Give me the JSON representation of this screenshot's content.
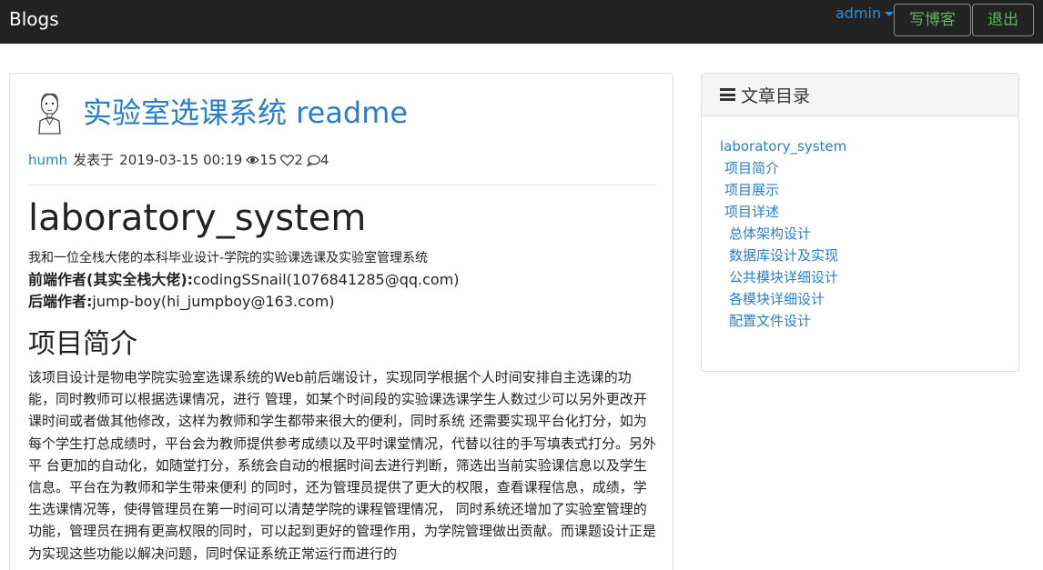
{
  "navbar": {
    "brand": "Blogs",
    "user": "admin",
    "write_label": "写博客",
    "logout_label": "退出"
  },
  "article": {
    "title": "实验室选课系统 readme",
    "author": "humh",
    "posted_prefix": "发表于",
    "datetime": "2019-03-15 00:19",
    "views": "15",
    "likes": "2",
    "comments": "4",
    "content": {
      "h1": "laboratory_system",
      "intro": "我和一位全栈大佬的本科毕业设计-学院的实验课选课及实验室管理系统",
      "frontend_label": "前端作者(其实全栈大佬):",
      "frontend_value": "codingSSnail(1076841285@qq.com)",
      "backend_label": "后端作者:",
      "backend_value": "jump-boy(hi_jumpboy@163.com)",
      "h2": "项目简介",
      "body": "该项目设计是物电学院实验室选课系统的Web前后端设计，实现同学根据个人时间安排自主选课的功能，同时教师可以根据选课情况，进行 管理，如某个时间段的实验课选课学生人数过少可以另外更改开课时间或者做其他修改，这样为教师和学生都带来很大的便利，同时系统 还需要实现平台化打分，如为每个学生打总成绩时，平台会为教师提供参考成绩以及平时课堂情况，代替以往的手写填表式打分。另外平 台更加的自动化，如随堂打分，系统会自动的根据时间去进行判断，筛选出当前实验课信息以及学生信息。平台在为教师和学生带来便利 的同时，还为管理员提供了更大的权限，查看课程信息，成绩，学生选课情况等，使得管理员在第一时间可以清楚学院的课程管理情况， 同时系统还增加了实验室管理的功能，管理员在拥有更高权限的同时，可以起到更好的管理作用，为学院管理做出贡献。而课题设计正是 为实现这些功能以解决问题，同时保证系统正常运行而进行的"
    }
  },
  "toc": {
    "title": "文章目录",
    "items": [
      {
        "label": "laboratory_system",
        "level": 1
      },
      {
        "label": "项目简介",
        "level": 2
      },
      {
        "label": "项目展示",
        "level": 2
      },
      {
        "label": "项目详述",
        "level": 2
      },
      {
        "label": "总体架构设计",
        "level": 3
      },
      {
        "label": "数据库设计及实现",
        "level": 3
      },
      {
        "label": "公共模块详细设计",
        "level": 3
      },
      {
        "label": "各模块详细设计",
        "level": 3
      },
      {
        "label": "配置文件设计",
        "level": 3
      }
    ]
  }
}
